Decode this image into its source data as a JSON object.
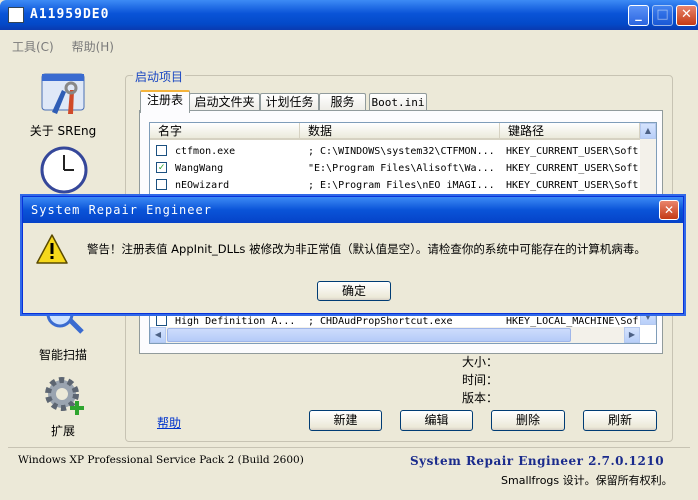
{
  "window": {
    "title": "A11959DE0"
  },
  "menu": [
    {
      "label": "工具(C)"
    },
    {
      "label": "帮助(H)"
    }
  ],
  "nav": {
    "about": "关于 SREng",
    "smart_scan": "智能扫描",
    "extend": "扩展"
  },
  "group": {
    "title": "启动项目"
  },
  "tabs": [
    {
      "label": "注册表",
      "active": true
    },
    {
      "label": "启动文件夹"
    },
    {
      "label": "计划任务"
    },
    {
      "label": "服务"
    },
    {
      "label": "Boot.ini"
    }
  ],
  "list": {
    "headers": [
      "名字",
      "数据",
      "键路径"
    ],
    "rows": [
      {
        "checked": false,
        "name": "ctfmon.exe",
        "data": "; C:\\WINDOWS\\system32\\CTFMON...",
        "key": "HKEY_CURRENT_USER\\Soft"
      },
      {
        "checked": true,
        "name": "WangWang",
        "data": "\"E:\\Program Files\\Alisoft\\Wa...",
        "key": "HKEY_CURRENT_USER\\Soft"
      },
      {
        "checked": false,
        "name": "nEOwizard",
        "data": "; E:\\Program Files\\nEO iMAGI...",
        "key": "HKEY_CURRENT_USER\\Soft"
      },
      {
        "checked": false,
        "name": "High Definition A...",
        "data": "; CHDAudPropShortcut.exe",
        "key": "HKEY_LOCAL_MACHINE\\Sof"
      }
    ]
  },
  "info": {
    "size_label": "大小：",
    "time_label": "时间：",
    "version_label": "版本："
  },
  "help_link": "帮助",
  "buttons": {
    "new": "新建",
    "edit": "编辑",
    "delete": "删除",
    "refresh": "刷新"
  },
  "status": {
    "os": "Windows XP Professional Service Pack 2 (Build 2600)",
    "product": "System Repair Engineer 2.7.0.1210",
    "copyright": "Smallfrogs 设计。保留所有权利。"
  },
  "dialog": {
    "title": "System Repair Engineer",
    "message": "警告！注册表值 AppInit_DLLs 被修改为非正常值（默认值是空）。请检查你的系统中可能存在的计算机病毒。",
    "ok": "确定"
  },
  "colors": {
    "title_blue": "#0a54d8",
    "accent_orange": "#f4b33b",
    "close_red": "#c43a16",
    "product_blue": "#1a2b8c"
  }
}
